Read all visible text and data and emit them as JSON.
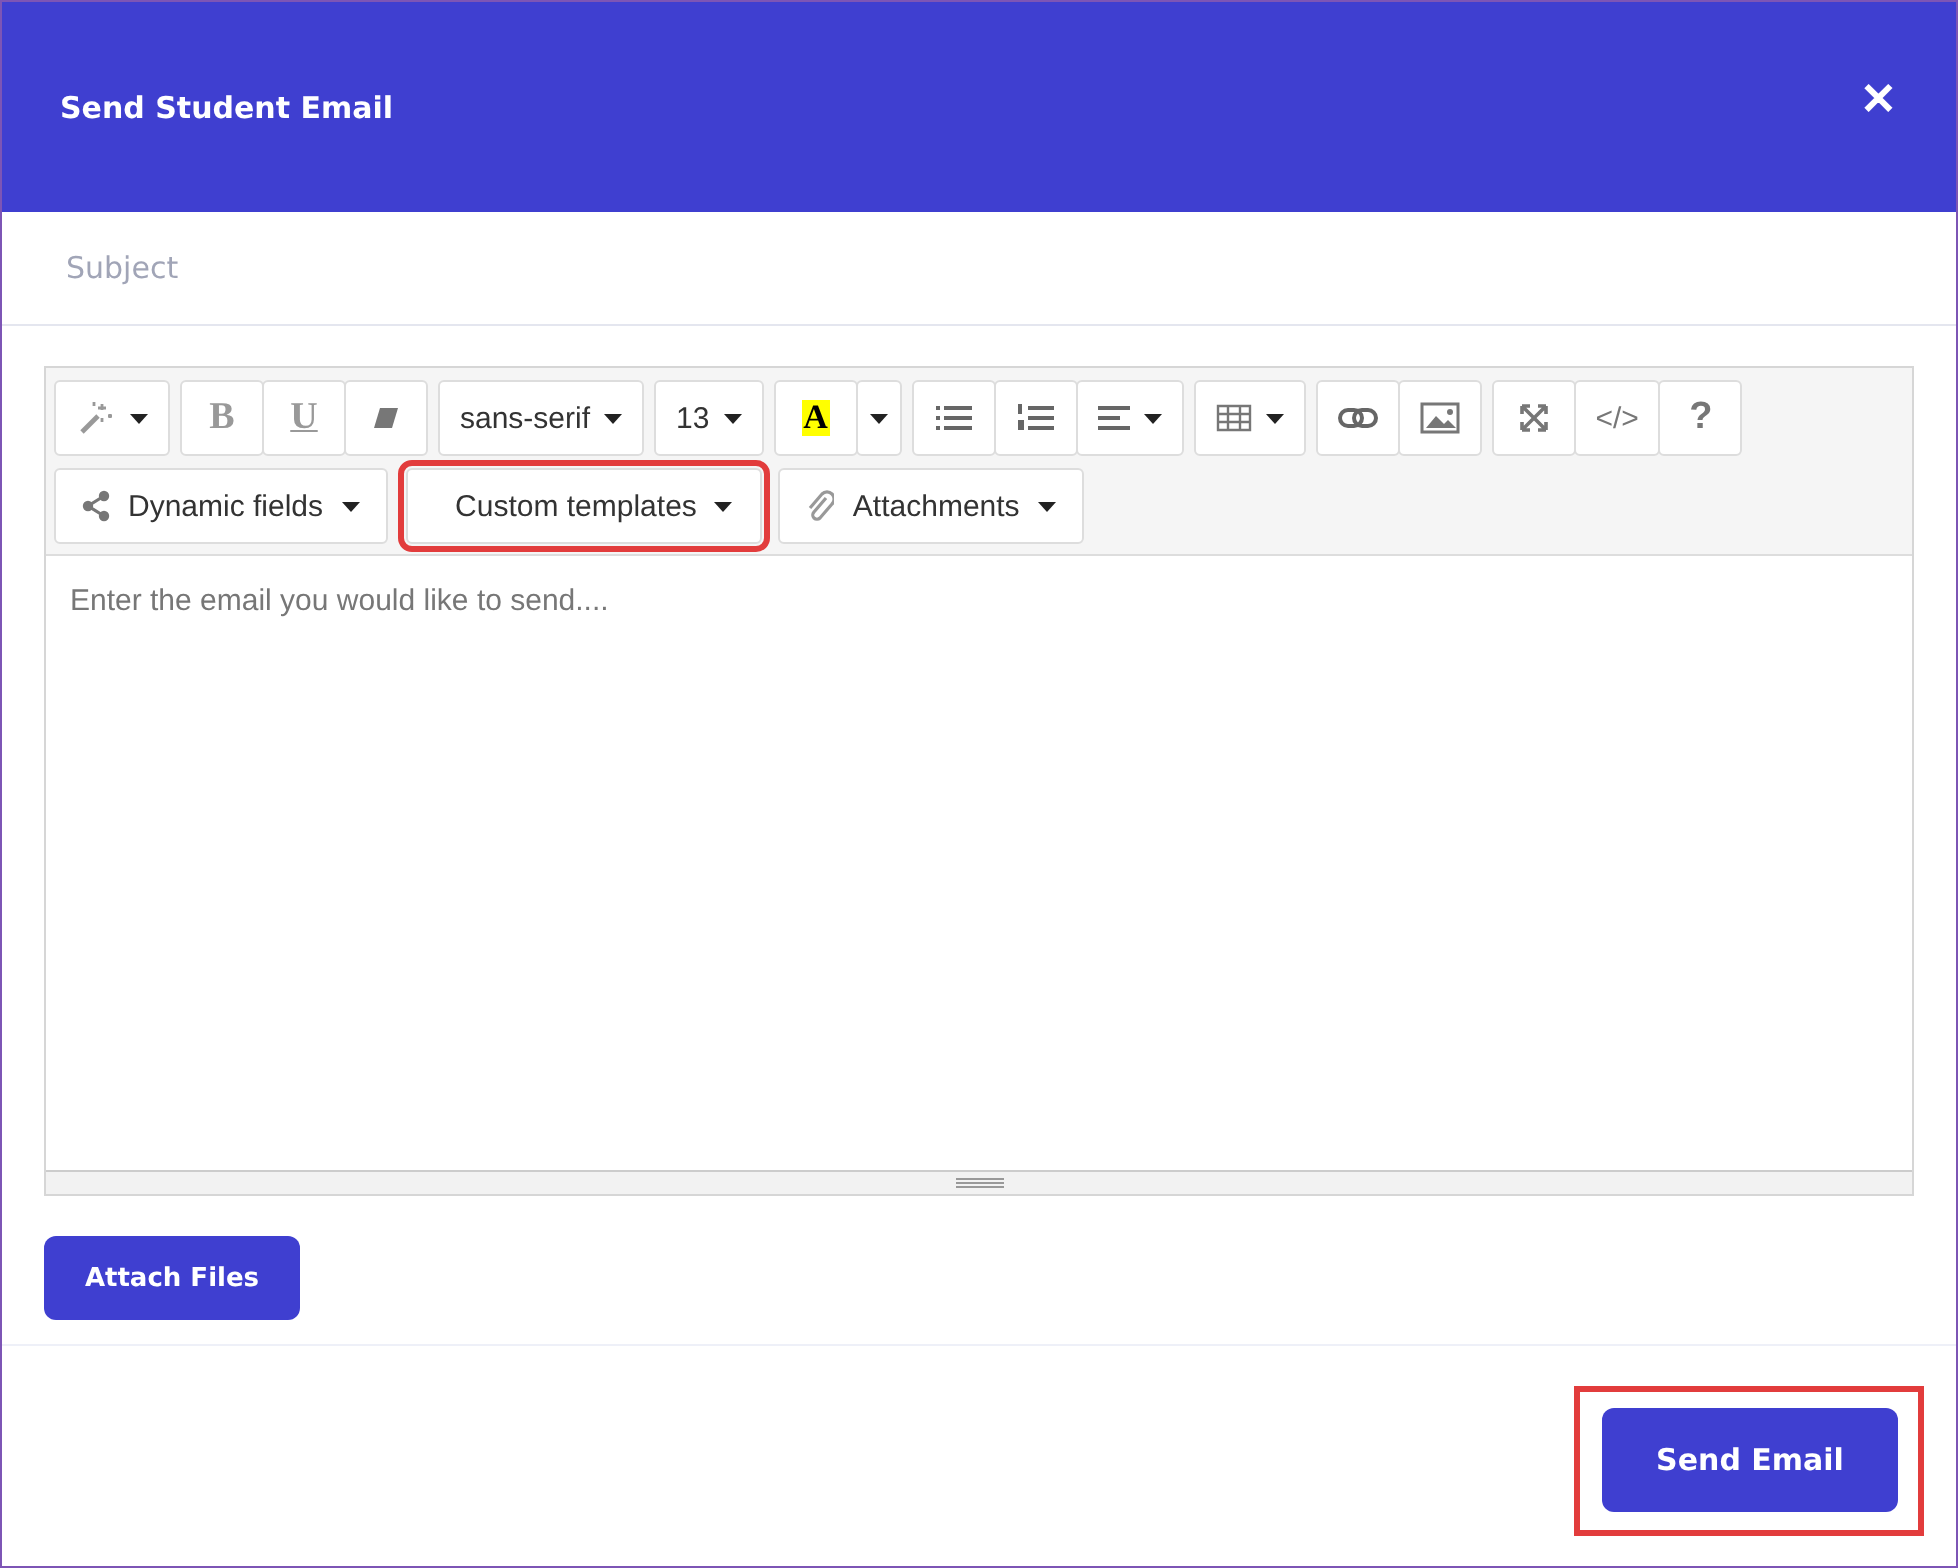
{
  "dialog": {
    "title": "Send Student Email",
    "close": "✕"
  },
  "subject": {
    "placeholder": "Subject"
  },
  "editor": {
    "toolbar_row_1": [
      [
        {
          "kind": "magic",
          "caret": true
        }
      ],
      [
        {
          "kind": "bold",
          "label": "B",
          "caret": false
        },
        {
          "kind": "underline",
          "label": "U",
          "caret": false
        },
        {
          "kind": "eraser",
          "caret": false
        }
      ],
      [
        {
          "kind": "text",
          "label": "sans-serif",
          "caret": true
        }
      ],
      [
        {
          "kind": "text",
          "label": "13",
          "caret": true
        }
      ],
      [
        {
          "kind": "color",
          "label": "A",
          "caret": false
        },
        {
          "kind": "blank",
          "caret": true
        }
      ],
      [
        {
          "kind": "bullets",
          "caret": false
        },
        {
          "kind": "numbers",
          "caret": false
        },
        {
          "kind": "align",
          "caret": true
        }
      ],
      [
        {
          "kind": "table",
          "caret": true
        }
      ],
      [
        {
          "kind": "link",
          "caret": false
        },
        {
          "kind": "image",
          "caret": false
        }
      ],
      [
        {
          "kind": "fullscreen",
          "caret": false
        },
        {
          "kind": "code",
          "label": "</>",
          "caret": false
        },
        {
          "kind": "help",
          "label": "?",
          "caret": false
        }
      ]
    ],
    "toolbar_row_2": [
      {
        "kind": "share",
        "label": "Dynamic fields",
        "highlighted": false
      },
      {
        "kind": "none",
        "label": "Custom templates",
        "highlighted": true
      },
      {
        "kind": "clip",
        "label": "Attachments",
        "highlighted": false
      }
    ],
    "placeholder": "Enter the email you would like to send...."
  },
  "attach_button": "Attach Files",
  "send_button": {
    "label": "Send Email",
    "highlighted": true
  }
}
